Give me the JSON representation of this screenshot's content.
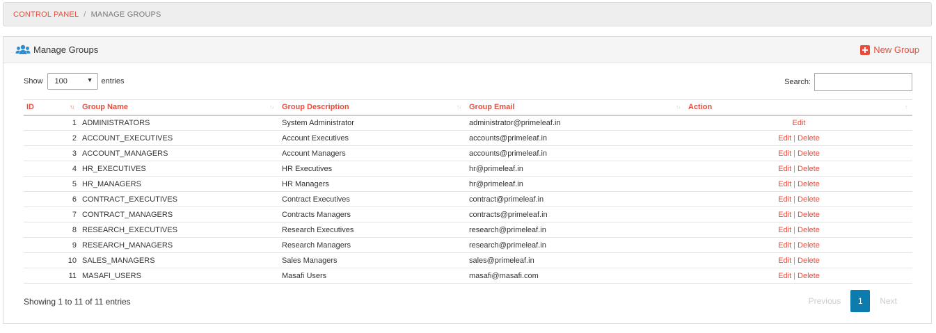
{
  "breadcrumb": {
    "root": "CONTROL PANEL",
    "separator": "/",
    "current": "MANAGE GROUPS"
  },
  "panel": {
    "title": "Manage Groups",
    "new_button": "New Group",
    "icon": "users-icon"
  },
  "controls": {
    "show_label": "Show",
    "entries_value": "100",
    "entries_label": "entries",
    "search_label": "Search:",
    "search_value": ""
  },
  "table": {
    "headers": {
      "id": "ID",
      "name": "Group Name",
      "description": "Group Description",
      "email": "Group Email",
      "action": "Action"
    },
    "rows": [
      {
        "id": "1",
        "name": "ADMINISTRATORS",
        "description": "System Administrator",
        "email": "administrator@primeleaf.in",
        "edit": "Edit",
        "delete": ""
      },
      {
        "id": "2",
        "name": "ACCOUNT_EXECUTIVES",
        "description": "Account Executives",
        "email": "accounts@primeleaf.in",
        "edit": "Edit",
        "delete": "Delete"
      },
      {
        "id": "3",
        "name": "ACCOUNT_MANAGERS",
        "description": "Account Managers",
        "email": "accounts@primeleaf.in",
        "edit": "Edit",
        "delete": "Delete"
      },
      {
        "id": "4",
        "name": "HR_EXECUTIVES",
        "description": "HR Executives",
        "email": "hr@primeleaf.in",
        "edit": "Edit",
        "delete": "Delete"
      },
      {
        "id": "5",
        "name": "HR_MANAGERS",
        "description": "HR Managers",
        "email": "hr@primeleaf.in",
        "edit": "Edit",
        "delete": "Delete"
      },
      {
        "id": "6",
        "name": "CONTRACT_EXECUTIVES",
        "description": "Contract Executives",
        "email": "contract@primeleaf.in",
        "edit": "Edit",
        "delete": "Delete"
      },
      {
        "id": "7",
        "name": "CONTRACT_MANAGERS",
        "description": "Contracts Managers",
        "email": "contracts@primeleaf.in",
        "edit": "Edit",
        "delete": "Delete"
      },
      {
        "id": "8",
        "name": "RESEARCH_EXECUTIVES",
        "description": "Research Executives",
        "email": "research@primeleaf.in",
        "edit": "Edit",
        "delete": "Delete"
      },
      {
        "id": "9",
        "name": "RESEARCH_MANAGERS",
        "description": "Research Managers",
        "email": "research@primeleaf.in",
        "edit": "Edit",
        "delete": "Delete"
      },
      {
        "id": "10",
        "name": "SALES_MANAGERS",
        "description": "Sales Managers",
        "email": "sales@primeleaf.in",
        "edit": "Edit",
        "delete": "Delete"
      },
      {
        "id": "11",
        "name": "MASAFI_USERS",
        "description": "Masafi Users",
        "email": "masafi@masafi.com",
        "edit": "Edit",
        "delete": "Delete"
      }
    ]
  },
  "footer": {
    "info": "Showing 1 to 11 of 11 entries",
    "prev": "Previous",
    "page": "1",
    "next": "Next"
  },
  "colors": {
    "accent": "#e74c3c",
    "page_active": "#0c7caf",
    "icon_blue": "#2f8ccf"
  }
}
